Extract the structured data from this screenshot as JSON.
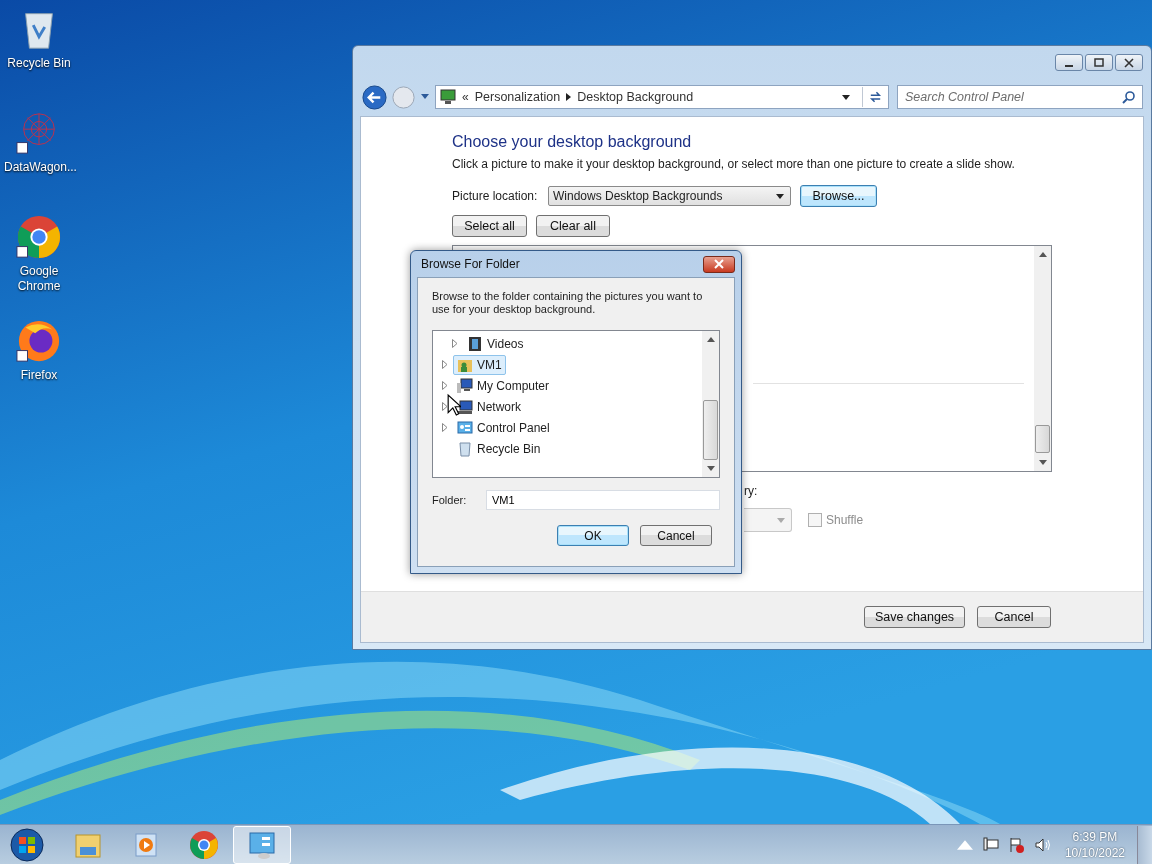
{
  "desktop_icons": [
    {
      "label": "Recycle Bin",
      "kind": "recycle"
    },
    {
      "label": "DataWagon...",
      "kind": "datawagon"
    },
    {
      "label": "Google Chrome",
      "kind": "chrome"
    },
    {
      "label": "Firefox",
      "kind": "firefox"
    }
  ],
  "window": {
    "breadcrumb_prefix": "«",
    "breadcrumb": [
      "Personalization",
      "Desktop Background"
    ],
    "search": {
      "placeholder": "Search Control Panel"
    },
    "heading": "Choose your desktop background",
    "description": "Click a picture to make it your desktop background, or select more than one picture to create a slide show.",
    "location_label": "Picture location:",
    "location_value": "Windows Desktop Backgrounds",
    "browse_button": "Browse...",
    "select_all": "Select all",
    "clear_all": "Clear all",
    "partial_label": "ry:",
    "shuffle": {
      "label": "Shuffle",
      "checked": false,
      "disabled": true
    },
    "buttons": [
      "Save changes",
      "Cancel"
    ]
  },
  "dialog": {
    "title": "Browse For Folder",
    "instruction": "Browse to the folder containing the pictures you want to use for your desktop background.",
    "tree": [
      {
        "children": [
          {
            "label": "Videos",
            "kind": "videos",
            "expandable": true,
            "selected": false
          }
        ]
      },
      {
        "label": "VM1",
        "kind": "user",
        "expandable": true,
        "selected": true
      },
      {
        "label": "My Computer",
        "kind": "computer",
        "expandable": true,
        "selected": false
      },
      {
        "label": "Network",
        "kind": "network",
        "expandable": true,
        "selected": false
      },
      {
        "label": "Control Panel",
        "kind": "control-panel",
        "expandable": true,
        "selected": false
      },
      {
        "label": "Recycle Bin",
        "kind": "recycle",
        "expandable": false,
        "selected": false
      }
    ],
    "folder_label": "Folder:",
    "folder_value": "VM1",
    "buttons": [
      {
        "label": "OK",
        "default": true
      },
      {
        "label": "Cancel",
        "default": false
      }
    ]
  },
  "taskbar": {
    "apps": [
      {
        "kind": "explorer",
        "active": false
      },
      {
        "kind": "media",
        "active": false
      },
      {
        "kind": "chrome",
        "active": false
      },
      {
        "kind": "control-panel",
        "active": true
      }
    ],
    "clock": {
      "time": "6:39 PM",
      "date": "10/10/2022"
    }
  }
}
